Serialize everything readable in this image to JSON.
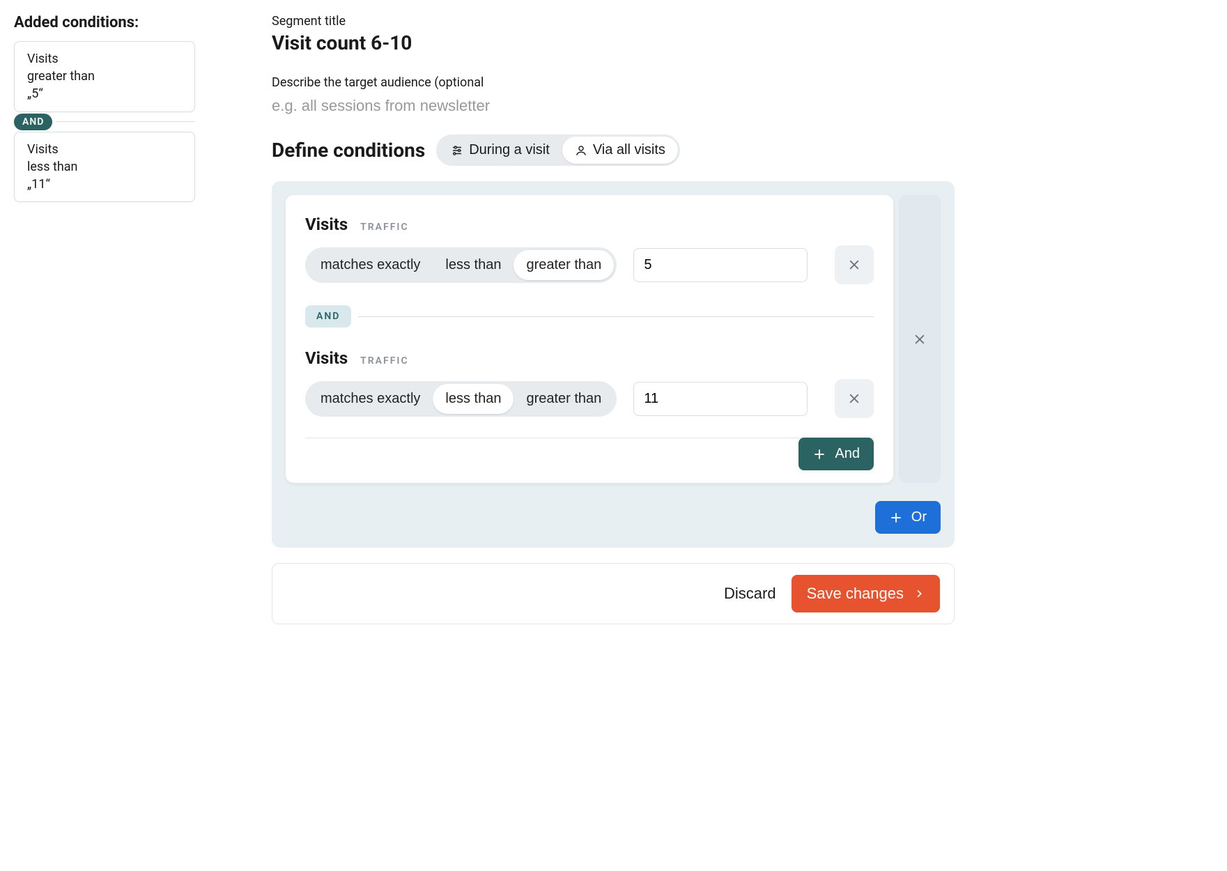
{
  "sidebar": {
    "title": "Added conditions:",
    "and_label": "AND",
    "cards": [
      {
        "metric": "Visits",
        "operator": "greater than",
        "value_display": "„5“"
      },
      {
        "metric": "Visits",
        "operator": "less than",
        "value_display": "„11“"
      }
    ]
  },
  "segment": {
    "title_label": "Segment title",
    "title": "Visit count 6-10",
    "desc_label": "Describe the target audience (optional",
    "desc_placeholder": "e.g. all sessions from newsletter",
    "desc_value": ""
  },
  "define": {
    "heading": "Define conditions",
    "scope_options": [
      {
        "label": "During a visit",
        "active": false
      },
      {
        "label": "Via all visits",
        "active": true
      }
    ]
  },
  "group": {
    "and_label": "AND",
    "add_and_label": "And",
    "conditions": [
      {
        "metric": "Visits",
        "category": "TRAFFIC",
        "operators": [
          "matches exactly",
          "less than",
          "greater than"
        ],
        "active_operator": "greater than",
        "value": "5"
      },
      {
        "metric": "Visits",
        "category": "TRAFFIC",
        "operators": [
          "matches exactly",
          "less than",
          "greater than"
        ],
        "active_operator": "less than",
        "value": "11"
      }
    ]
  },
  "or_label": "Or",
  "footer": {
    "discard": "Discard",
    "save": "Save changes"
  }
}
